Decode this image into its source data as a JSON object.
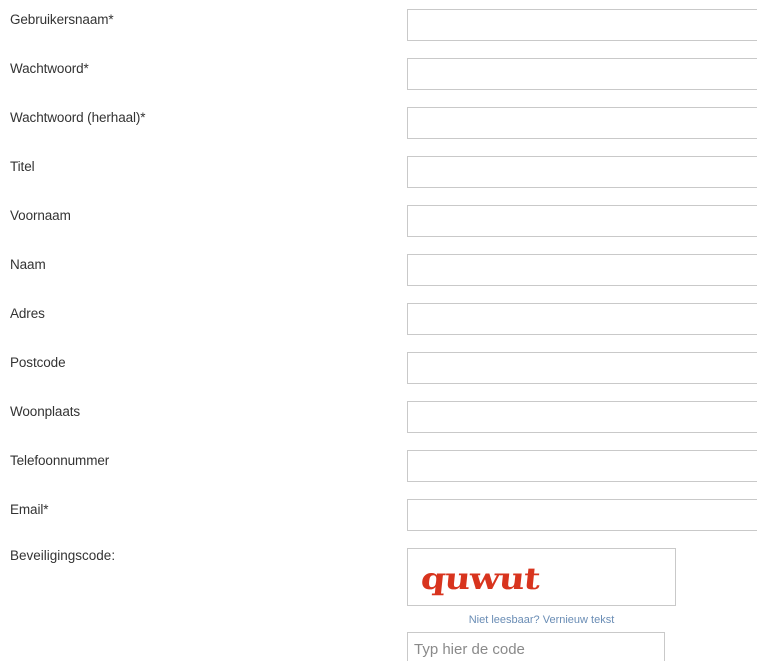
{
  "form": {
    "fields": [
      {
        "label": "Gebruikersnaam*",
        "value": ""
      },
      {
        "label": "Wachtwoord*",
        "value": ""
      },
      {
        "label": "Wachtwoord (herhaal)*",
        "value": ""
      },
      {
        "label": "Titel",
        "value": ""
      },
      {
        "label": "Voornaam",
        "value": ""
      },
      {
        "label": "Naam",
        "value": ""
      },
      {
        "label": "Adres",
        "value": ""
      },
      {
        "label": "Postcode",
        "value": ""
      },
      {
        "label": "Woonplaats",
        "value": ""
      },
      {
        "label": "Telefoonnummer",
        "value": ""
      },
      {
        "label": "Email*",
        "value": ""
      }
    ],
    "captcha": {
      "label": "Beveiligingscode:",
      "image_text": "quwut",
      "refresh_link": "Niet leesbaar? Vernieuw tekst",
      "input_placeholder": "Typ hier de code",
      "text_color": "#d8341e"
    }
  }
}
